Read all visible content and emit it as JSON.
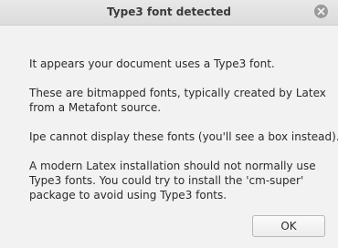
{
  "window": {
    "title": "Type3 font detected",
    "close_icon": "close-icon"
  },
  "message": {
    "p1": [
      "It appears your document uses a Type3 font."
    ],
    "p2": [
      "These are bitmapped fonts, typically created by Latex",
      "from a Metafont source."
    ],
    "p3": [
      "Ipe cannot display these fonts (you'll see a box instead)."
    ],
    "p4": [
      "A modern Latex installation should not normally use",
      "Type3 fonts. You could try to install the 'cm-super'",
      "package to avoid using Type3 fonts."
    ]
  },
  "buttons": {
    "ok_label": "OK"
  },
  "colors": {
    "background": "#f2f2f2",
    "titlebar": "#dcdcdc",
    "close_button": "#9a9a9a"
  }
}
